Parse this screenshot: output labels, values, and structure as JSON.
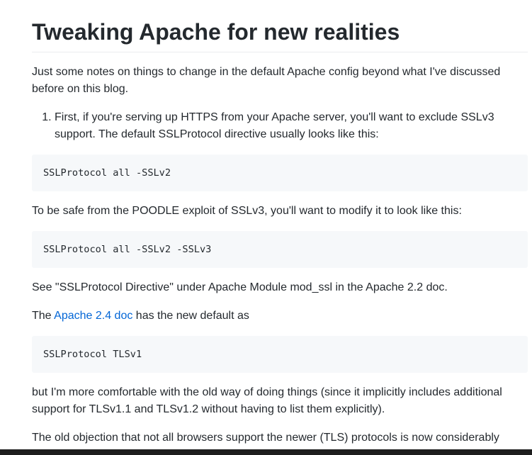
{
  "article": {
    "title": "Tweaking Apache for new realities",
    "intro": "Just some notes on things to change in the default Apache config beyond what I've discussed before on this blog.",
    "list_item_1": "First, if you're serving up HTTPS from your Apache server, you'll want to exclude SSLv3 support. The default SSLProtocol directive usually looks like this:",
    "code_1": "SSLProtocol all -SSLv2",
    "para_poodle": "To be safe from the POODLE exploit of SSLv3, you'll want to modify it to look like this:",
    "code_2": "SSLProtocol all -SSLv2 -SSLv3",
    "para_see": "See \"SSLProtocol Directive\" under Apache Module mod_ssl in the Apache 2.2 doc.",
    "para_24_prefix": "The ",
    "para_24_link": "Apache 2.4 doc",
    "para_24_suffix": " has the new default as",
    "code_3": "SSLProtocol TLSv1",
    "para_but": "but I'm more comfortable with the old way of doing things (since it implicitly includes additional support for TLSv1.1 and TLSv1.2 without having to list them explicitly).",
    "para_old": "The old objection that not all browsers support the newer (TLS) protocols is now considerably"
  },
  "colors": {
    "text": "#24292e",
    "link": "#0366d6",
    "code_bg": "#f6f8fa",
    "rule": "#eaecef"
  }
}
